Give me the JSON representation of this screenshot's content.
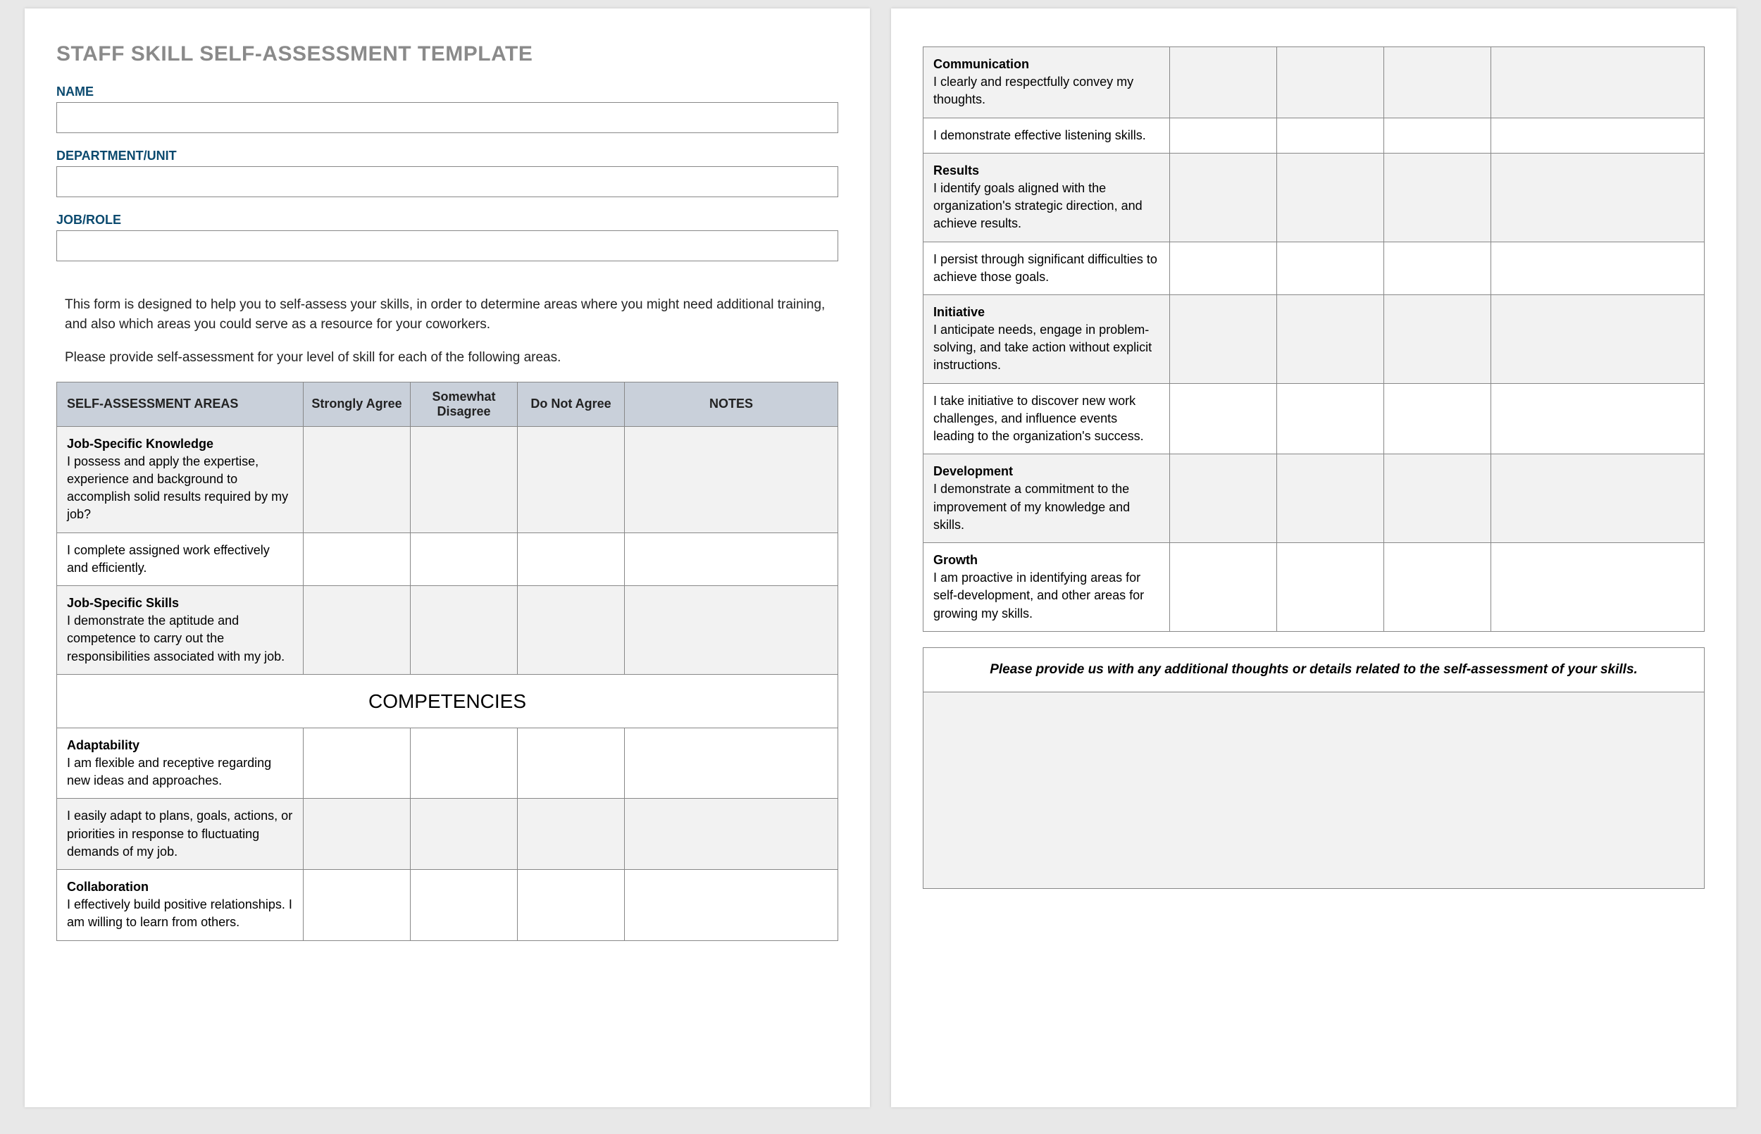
{
  "title": "STAFF SKILL SELF-ASSESSMENT TEMPLATE",
  "fields": {
    "name_label": "NAME",
    "dept_label": "DEPARTMENT/UNIT",
    "job_label": "JOB/ROLE"
  },
  "intro": {
    "p1": "This form is designed to help you to self-assess your skills, in order to determine areas where you might need additional training, and also which areas you could serve as a resource for your coworkers.",
    "p2": "Please provide self-assessment for your level of skill for each of the following areas."
  },
  "columns": {
    "areas": "SELF-ASSESSMENT AREAS",
    "strongly": "Strongly Agree",
    "somewhat": "Somewhat Disagree",
    "donot": "Do Not Agree",
    "notes": "NOTES"
  },
  "competencies_header": "COMPETENCIES",
  "rows_page1": [
    {
      "heading": "Job-Specific Knowledge",
      "text": "I possess and apply the expertise, experience and background to accomplish solid results required by my job?",
      "shaded": true
    },
    {
      "heading": "",
      "text": "I complete assigned work effectively and efficiently.",
      "shaded": false
    },
    {
      "heading": "Job-Specific Skills",
      "text": "I demonstrate the aptitude and competence to carry out the responsibilities associated with my job.",
      "shaded": true
    }
  ],
  "rows_competencies": [
    {
      "heading": "Adaptability",
      "text": "I am flexible and receptive regarding new ideas and approaches.",
      "shaded": false
    },
    {
      "heading": "",
      "text": "I easily adapt to plans, goals, actions, or priorities in response to fluctuating demands of my job.",
      "shaded": true
    },
    {
      "heading": "Collaboration",
      "text": "I effectively build positive relationships. I am willing to learn from others.",
      "shaded": false
    }
  ],
  "rows_page2": [
    {
      "heading": "Communication",
      "text": "I clearly and respectfully convey my thoughts.",
      "shaded": true
    },
    {
      "heading": "",
      "text": "I demonstrate effective listening skills.",
      "shaded": false
    },
    {
      "heading": "Results",
      "text": "I identify goals aligned with the organization's strategic direction, and achieve results.",
      "shaded": true
    },
    {
      "heading": "",
      "text": "I persist through significant difficulties to achieve those goals.",
      "shaded": false
    },
    {
      "heading": "Initiative",
      "text": "I anticipate needs, engage in problem-solving, and take action without explicit instructions.",
      "shaded": true
    },
    {
      "heading": "",
      "text": "I take initiative to discover new work challenges, and influence events leading to the organization's success.",
      "shaded": false
    },
    {
      "heading": "Development",
      "text": "I demonstrate a commitment to the improvement of my knowledge and skills.",
      "shaded": true
    },
    {
      "heading": "Growth",
      "text": "I am proactive in identifying areas for self-development, and other areas for growing my skills.",
      "shaded": false
    }
  ],
  "additional_label": "Please provide us with any additional thoughts or details related to the self-assessment of your skills."
}
